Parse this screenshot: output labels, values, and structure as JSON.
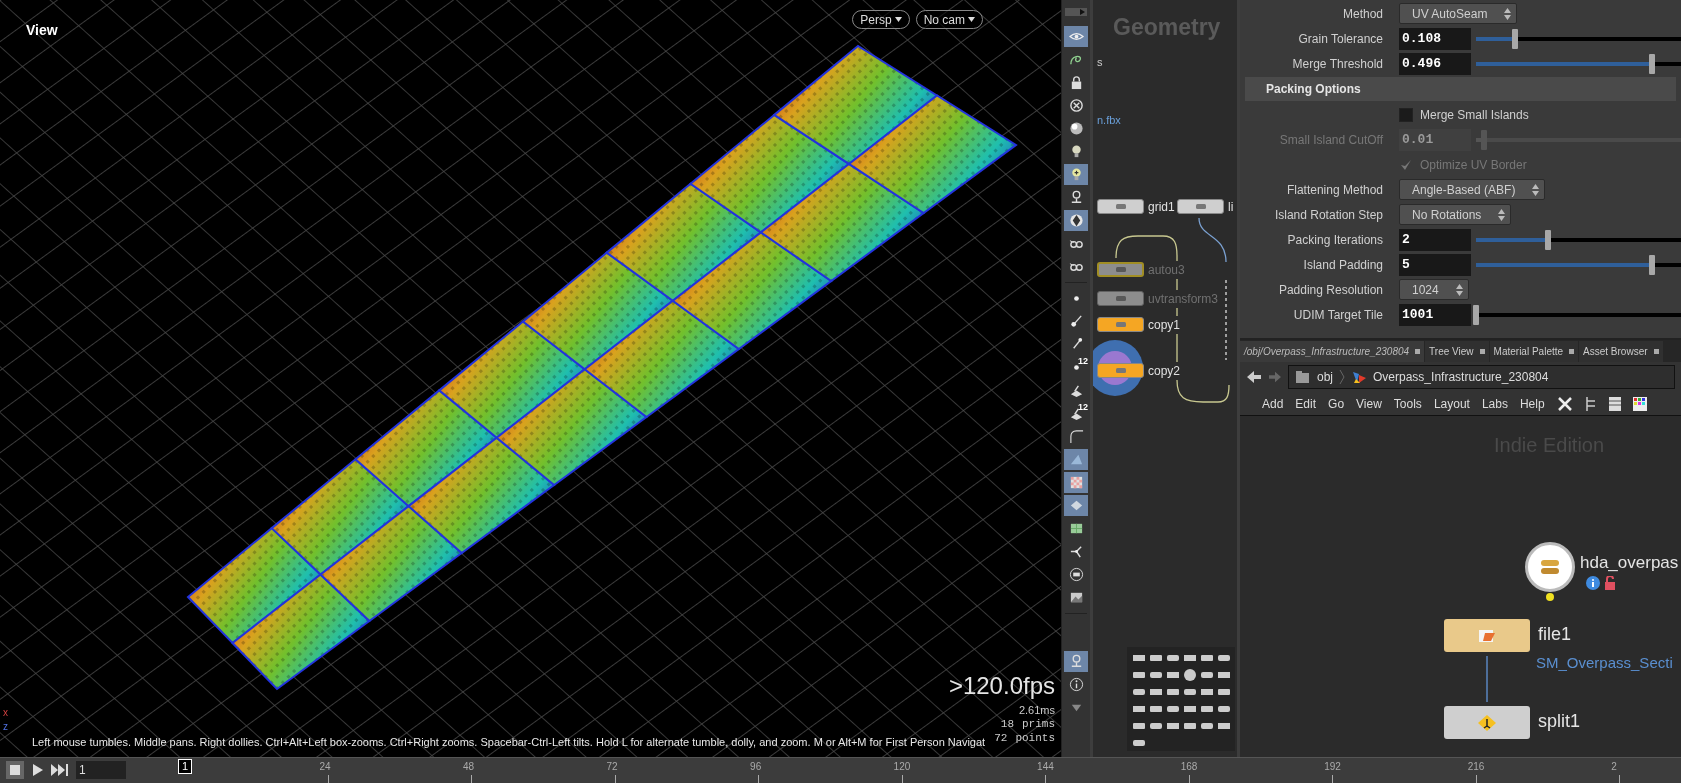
{
  "viewport": {
    "title": "View",
    "camera_menus": [
      "Persp",
      "No cam"
    ],
    "hint": "Left mouse tumbles. Middle pans. Right dollies. Ctrl+Alt+Left box-zooms. Ctrl+Right zooms. Spacebar-Ctrl-Left tilts. Hold L for alternate tumble, dolly, and zoom. M or Alt+M for First Person Navigat",
    "stats": {
      "fps": ">120.0fps",
      "time": "2.61ms",
      "prims_count": "18",
      "prims_label": "prims",
      "points_count": "72",
      "points_label": "points"
    },
    "axes": [
      "x",
      "z"
    ],
    "toolbar": [
      {
        "on": true
      },
      {
        "on": false
      },
      {
        "on": false
      },
      {
        "on": false
      },
      {
        "on": false
      },
      {
        "on": false
      },
      {
        "on": true
      },
      {
        "on": false
      },
      {
        "on": true
      },
      {
        "on": false
      },
      {
        "on": false
      },
      {
        "on": false
      },
      {
        "on": false
      },
      {
        "on": false
      },
      {
        "on": false,
        "badge": "12"
      },
      {
        "on": false
      },
      {
        "on": false,
        "badge": "12"
      },
      {
        "on": false
      },
      {
        "on": true
      },
      {
        "on": true
      },
      {
        "on": true
      },
      {
        "on": false
      },
      {
        "on": false
      },
      {
        "on": false
      },
      {
        "on": false
      },
      {
        "on": true
      },
      {
        "on": false
      },
      {
        "on": false
      }
    ]
  },
  "network_upper": {
    "title": "Geometry",
    "fragments": [
      {
        "text": "s",
        "kind": "plain"
      },
      {
        "text": "n.fbx",
        "kind": "link"
      }
    ],
    "nodes": [
      {
        "label": "grid1",
        "kind": "gray",
        "selected": false,
        "dimmed": false
      },
      {
        "label": "li",
        "kind": "gray",
        "selected": false,
        "dimmed": false
      },
      {
        "label": "autou3",
        "kind": "gray",
        "selected": true,
        "dimmed": true
      },
      {
        "label": "uvtransform3",
        "kind": "gray",
        "selected": false,
        "dimmed": true
      },
      {
        "label": "copy1",
        "kind": "orange",
        "selected": false,
        "dimmed": false
      },
      {
        "label": "copy2",
        "kind": "orange",
        "selected": false,
        "dimmed": false
      }
    ]
  },
  "parameters": {
    "rows": [
      {
        "kind": "dropdown",
        "label": "Method",
        "value": "UV AutoSeam",
        "disabled": false
      },
      {
        "kind": "slider",
        "label": "Grain Tolerance",
        "value": "0.108",
        "level": 0.19,
        "disabled": false
      },
      {
        "kind": "slider",
        "label": "Merge Threshold",
        "value": "0.496",
        "level": 0.86,
        "disabled": false
      },
      {
        "kind": "section",
        "label": "Packing Options"
      },
      {
        "kind": "checkbox",
        "label": "Merge Small Islands",
        "checked": false,
        "disabled": false
      },
      {
        "kind": "slider",
        "label": "Small Island CutOff",
        "value": "0.01",
        "level": 0.04,
        "disabled": true
      },
      {
        "kind": "checkbox",
        "label": "Optimize UV Border",
        "checked": true,
        "disabled": true
      },
      {
        "kind": "dropdown",
        "label": "Flattening Method",
        "value": "Angle-Based (ABF)",
        "disabled": false
      },
      {
        "kind": "dropdown",
        "label": "Island Rotation Step",
        "value": "No Rotations",
        "disabled": false
      },
      {
        "kind": "slider",
        "label": "Packing Iterations",
        "value": "2",
        "level": 0.35,
        "disabled": false
      },
      {
        "kind": "slider",
        "label": "Island Padding",
        "value": "5",
        "level": 0.86,
        "disabled": false
      },
      {
        "kind": "dropdown",
        "label": "Padding Resolution",
        "value": "1024",
        "disabled": false
      },
      {
        "kind": "slider",
        "label": "UDIM Target Tile",
        "value": "1001",
        "level": 0,
        "disabled": false
      }
    ]
  },
  "network": {
    "tabs": [
      {
        "label": "/obj/Overpass_Infrastructure_230804",
        "selected": true
      },
      {
        "label": "Tree View",
        "selected": false
      },
      {
        "label": "Material Palette",
        "selected": false
      },
      {
        "label": "Asset Browser",
        "selected": false
      }
    ],
    "path": [
      "obj",
      "Overpass_Infrastructure_230804"
    ],
    "menu": [
      "Add",
      "Edit",
      "Go",
      "View",
      "Tools",
      "Layout",
      "Labs",
      "Help"
    ],
    "edition": "Indie Edition",
    "nodes": [
      {
        "kind": "asset",
        "label": "hda_overpas"
      },
      {
        "kind": "file",
        "label": "file1",
        "sublabel": "SM_Overpass_Secti"
      },
      {
        "kind": "split",
        "label": "split1"
      }
    ]
  },
  "timeline": {
    "frame": "1",
    "marker": "1",
    "ticks": [
      "24",
      "48",
      "72",
      "96",
      "120",
      "144",
      "168",
      "192",
      "216",
      "2"
    ]
  }
}
